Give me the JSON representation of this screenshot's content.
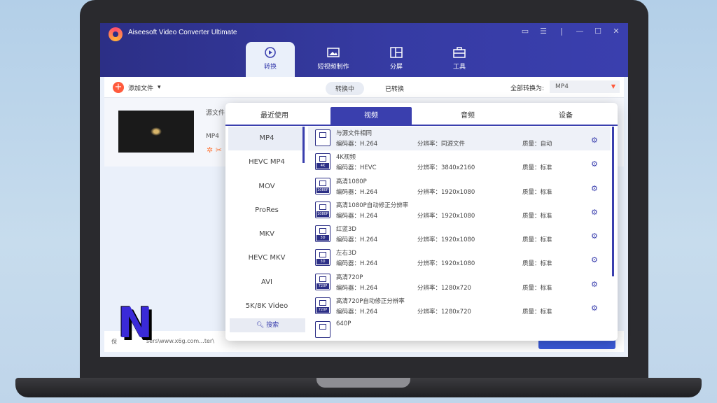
{
  "app": {
    "title": "Aiseesoft Video Converter Ultimate"
  },
  "main_tabs": [
    {
      "label": "转换",
      "icon": "convert-icon"
    },
    {
      "label": "短视频制作",
      "icon": "mv-icon"
    },
    {
      "label": "分屏",
      "icon": "collage-icon"
    },
    {
      "label": "工具",
      "icon": "toolbox-icon"
    }
  ],
  "toolbar": {
    "add_files": "添加文件",
    "seg_converting": "转换中",
    "seg_converted": "已转换",
    "convert_all_label": "全部转换为:",
    "convert_all_value": "MP4"
  },
  "file_row": {
    "source_label": "源文件",
    "format_label": "MP4"
  },
  "status_bar": {
    "save_label": "保",
    "path": "sers\\www.x6g.com...ter\\"
  },
  "popup": {
    "tabs": [
      "最近使用",
      "视频",
      "音频",
      "设备"
    ],
    "formats": [
      "MP4",
      "HEVC MP4",
      "MOV",
      "ProRes",
      "MKV",
      "HEVC MKV",
      "AVI",
      "5K/8K Video"
    ],
    "search": "搜索",
    "profiles": [
      {
        "name": "与源文件相同",
        "codec": "编码器：H.264",
        "res": "分辨率：同源文件",
        "quality": "质量：自动",
        "tag": ""
      },
      {
        "name": "4K视频",
        "codec": "编码器：HEVC",
        "res": "分辨率：3840x2160",
        "quality": "质量：标准",
        "tag": "4K"
      },
      {
        "name": "高清1080P",
        "codec": "编码器：H.264",
        "res": "分辨率：1920x1080",
        "quality": "质量：标准",
        "tag": "1080P"
      },
      {
        "name": "高清1080P自动修正分辨率",
        "codec": "编码器：H.264",
        "res": "分辨率：1920x1080",
        "quality": "质量：标准",
        "tag": "1080P"
      },
      {
        "name": "红蓝3D",
        "codec": "编码器：H.264",
        "res": "分辨率：1920x1080",
        "quality": "质量：标准",
        "tag": "3D"
      },
      {
        "name": "左右3D",
        "codec": "编码器：H.264",
        "res": "分辨率：1920x1080",
        "quality": "质量：标准",
        "tag": "3D"
      },
      {
        "name": "高清720P",
        "codec": "编码器：H.264",
        "res": "分辨率：1280x720",
        "quality": "质量：标准",
        "tag": "720P"
      },
      {
        "name": "高清720P自动修正分辨率",
        "codec": "编码器：H.264",
        "res": "分辨率：1280x720",
        "quality": "质量：标准",
        "tag": "720P"
      },
      {
        "name": "640P",
        "codec": "",
        "res": "",
        "quality": "",
        "tag": ""
      }
    ]
  },
  "watermark": {
    "letter": "N"
  }
}
